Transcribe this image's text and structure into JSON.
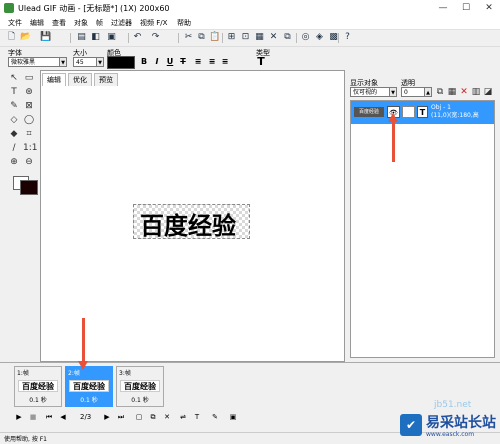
{
  "window": {
    "title": "Ulead GIF 动画 - [无标题*] (1X) 200x60",
    "controls": [
      "—",
      "☐",
      "✕"
    ]
  },
  "menu": [
    "文件",
    "编辑",
    "查看",
    "对象",
    "帧",
    "过滤器",
    "视频 F/X",
    "帮助"
  ],
  "properties": {
    "font_label": "字体",
    "font_value": "微软雅黑",
    "size_label": "大小",
    "size_value": "45",
    "color_label": "颜色",
    "type_label": "类型",
    "bold": "B",
    "italic": "I",
    "underline": "U",
    "strike": "T"
  },
  "editor_tabs": [
    "编辑",
    "优化",
    "预览"
  ],
  "canvas_text": "百度经验",
  "object_panel": {
    "display_label": "显示对象",
    "display_value": "仅可视的",
    "opacity_label": "透明",
    "opacity_value": "0",
    "row_thumb": "百度经验",
    "row_eye": "👁",
    "row_type": "T",
    "row_info_line1": "Obj - 1",
    "row_info_line2": "(11,0)(宽:180,高"
  },
  "frames": [
    {
      "label": "1:帧",
      "thumb": "百度经验",
      "delay": "0.1 秒"
    },
    {
      "label": "2:帧",
      "thumb": "百度经验",
      "delay": "0.1 秒"
    },
    {
      "label": "3:帧",
      "thumb": "百度经验",
      "delay": "0.1 秒"
    }
  ],
  "playback": {
    "counter": "2/3"
  },
  "status": {
    "text": "使用帮助, 按 F1"
  },
  "watermark": {
    "site": "易采站长站",
    "url": "www.easck.com",
    "partial": "jb51.net"
  },
  "colors": {
    "selection": "#3399ff",
    "annotation_arrow": "#e8503a",
    "text_color_swatch": "#000000"
  }
}
